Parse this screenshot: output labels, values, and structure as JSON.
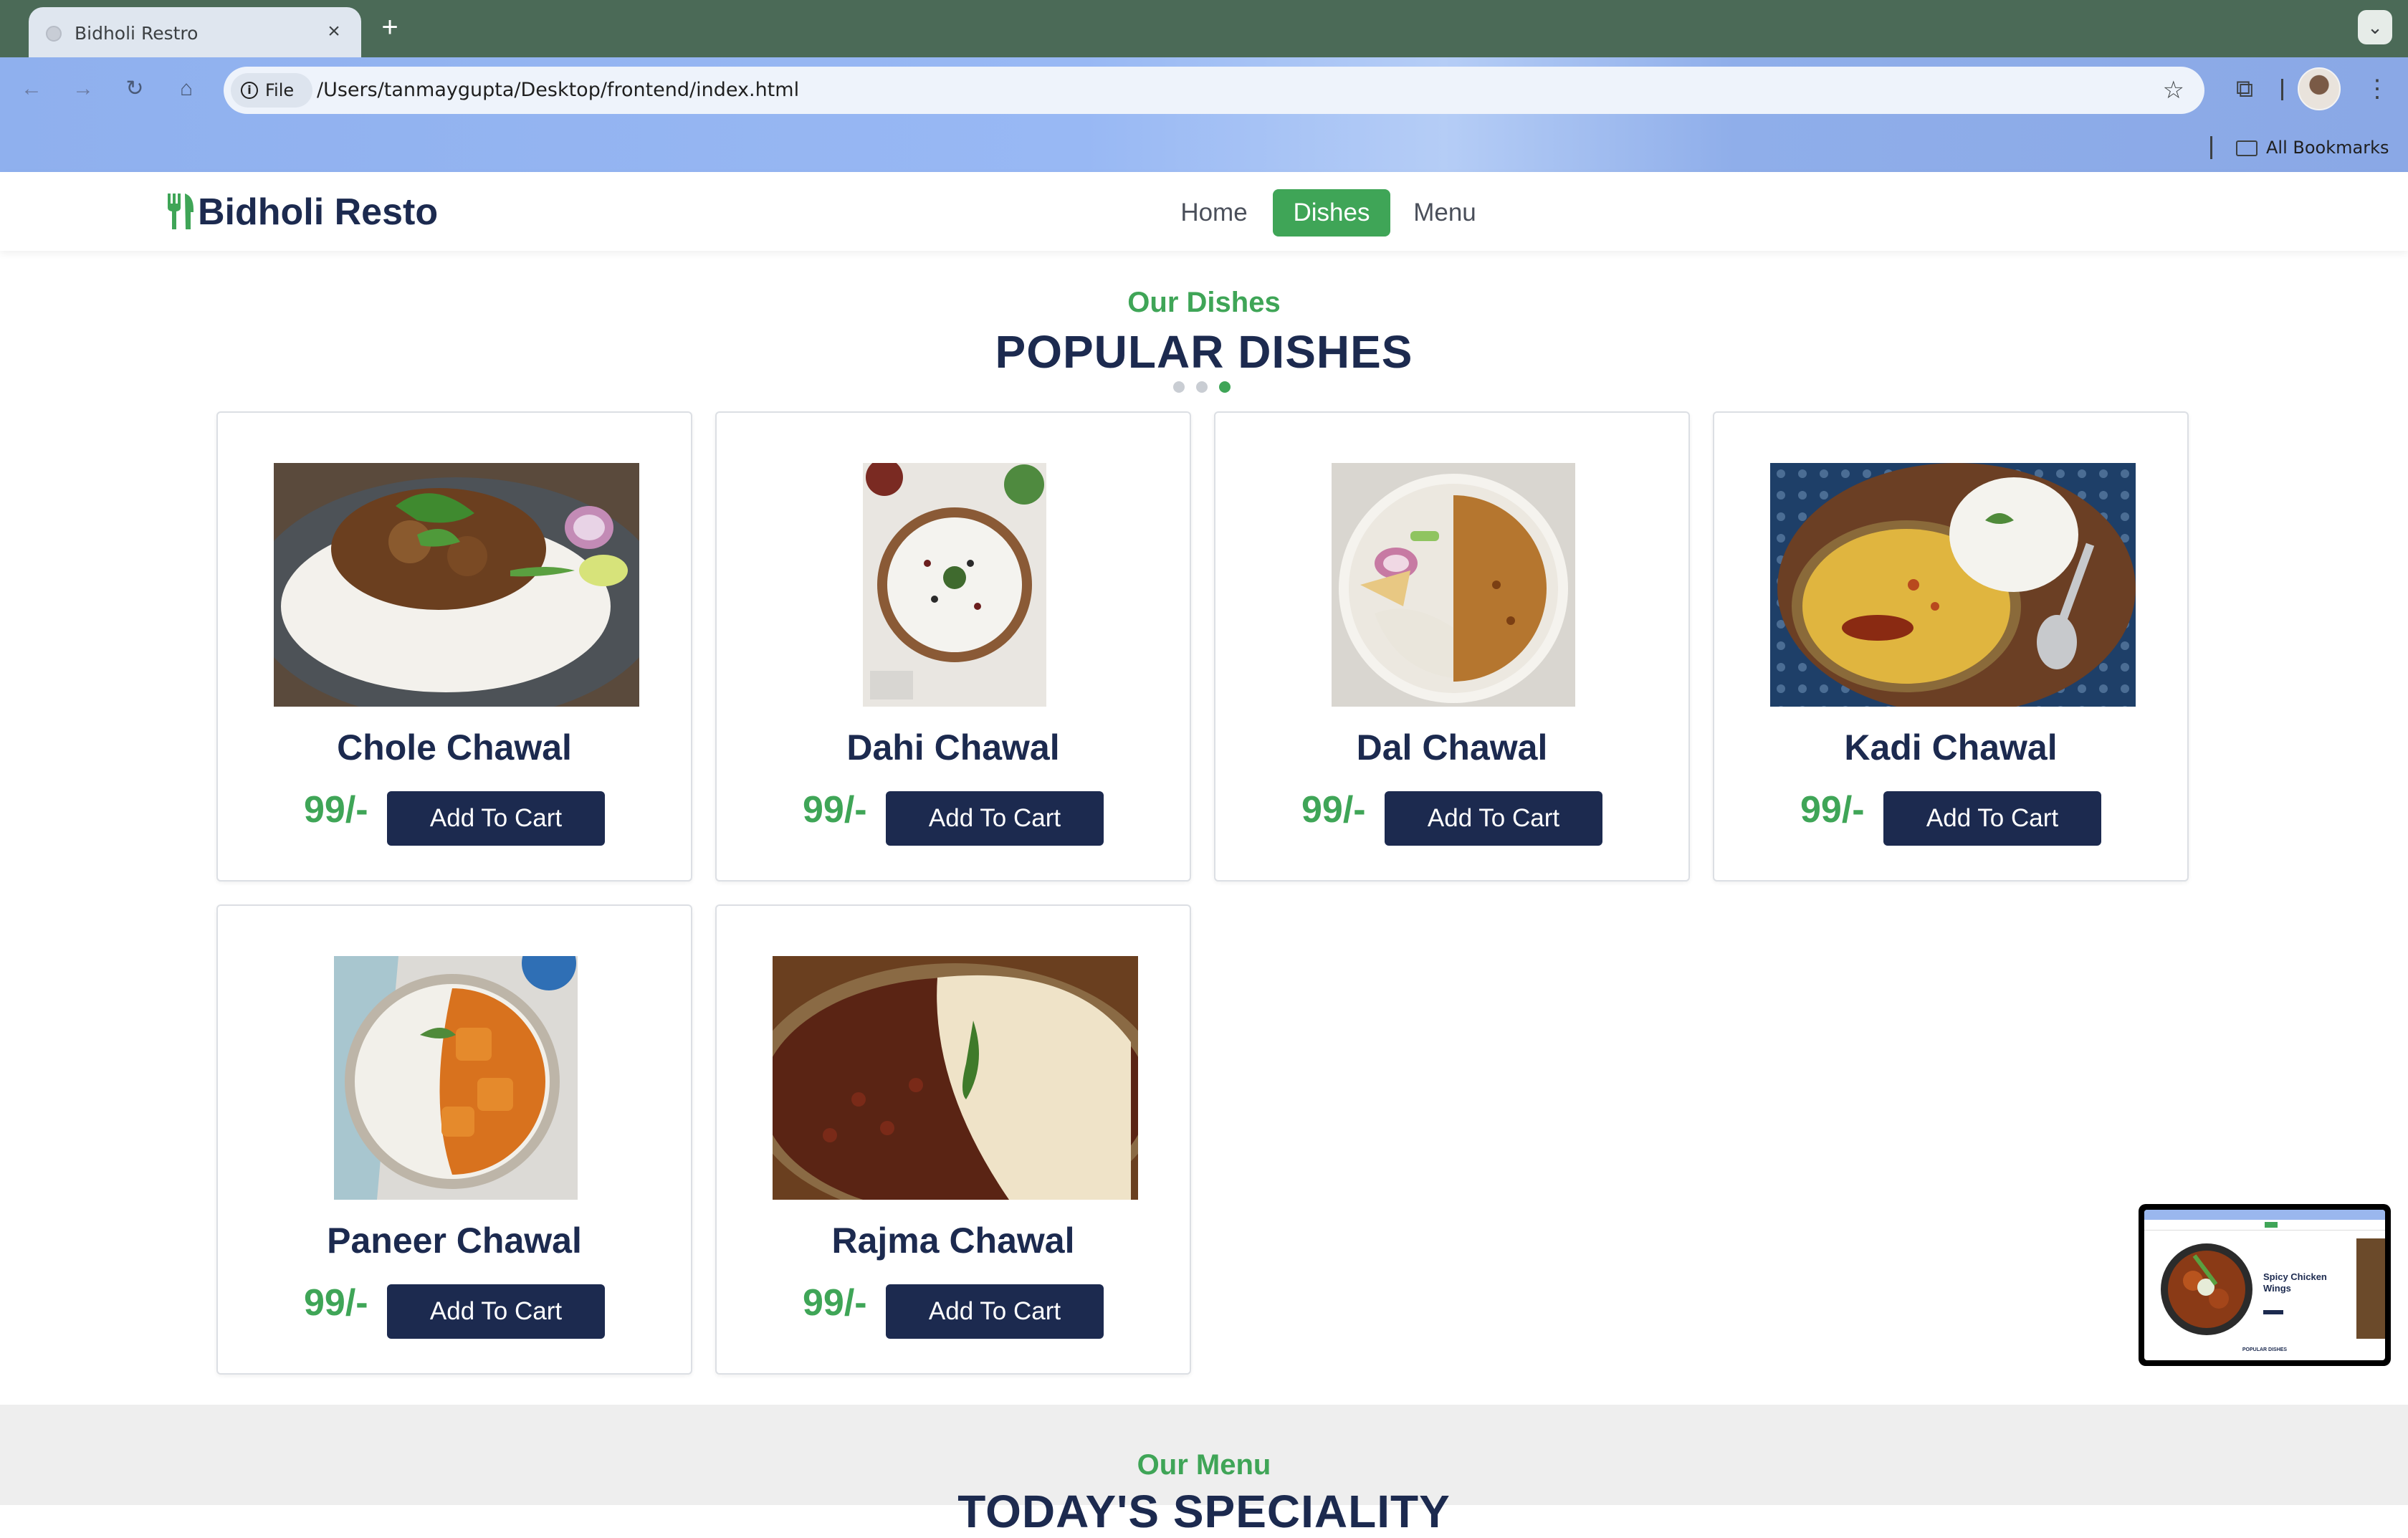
{
  "browser": {
    "tab_title": "Bidholi Restro",
    "chip_label": "File",
    "url": "/Users/tanmaygupta/Desktop/frontend/index.html",
    "bookmarks_label": "All Bookmarks"
  },
  "site": {
    "brand": "Bidholi Resto",
    "nav": [
      "Home",
      "Dishes",
      "Menu"
    ],
    "active_nav": "Dishes"
  },
  "dishes_section": {
    "subtitle": "Our Dishes",
    "title": "POPULAR DISHES",
    "carousel_dots": 3,
    "active_dot": 3
  },
  "dishes": [
    {
      "name": "Chole Chawal",
      "price": "99/-",
      "button": "Add To Cart"
    },
    {
      "name": "Dahi Chawal",
      "price": "99/-",
      "button": "Add To Cart"
    },
    {
      "name": "Dal Chawal",
      "price": "99/-",
      "button": "Add To Cart"
    },
    {
      "name": "Kadi Chawal",
      "price": "99/-",
      "button": "Add To Cart"
    },
    {
      "name": "Paneer Chawal",
      "price": "99/-",
      "button": "Add To Cart"
    },
    {
      "name": "Rajma Chawal",
      "price": "99/-",
      "button": "Add To Cart"
    }
  ],
  "menu_section": {
    "subtitle": "Our Menu",
    "title": "TODAY'S SPECIALITY"
  },
  "pip_preview": {
    "heading": "Spicy Chicken Wings",
    "footer": "POPULAR DISHES"
  },
  "colors": {
    "brand_green": "#3fa557",
    "navy": "#1c2a4f",
    "tabstrip": "#4b6a57"
  }
}
